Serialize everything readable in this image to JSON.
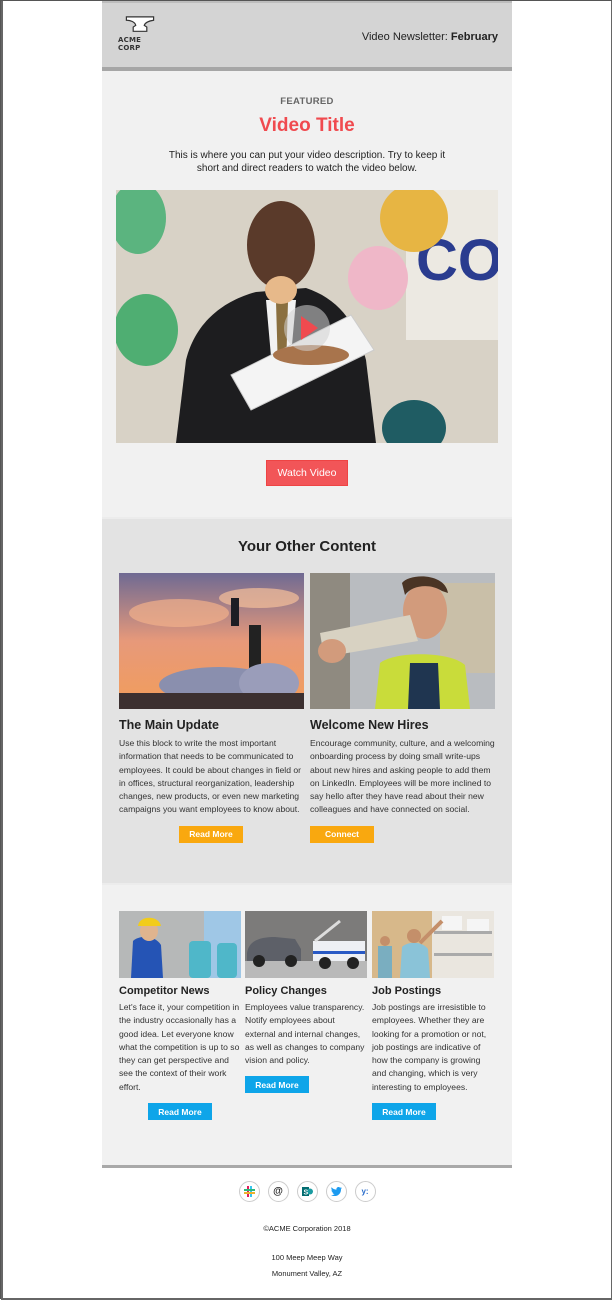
{
  "header": {
    "logo_text": "ACME CORP",
    "title_prefix": "Video Newsletter: ",
    "title_month": "February"
  },
  "featured": {
    "label": "FEATURED",
    "title": "Video Title",
    "description": "This is where you can put your video description. Try to keep it short and direct readers to watch the video below.",
    "thumbnail_alt": "Man in suit eating a sprinkled donut at an office party with balloons and streamers",
    "button_label": "Watch Video",
    "accent_color": "#f04a4f"
  },
  "other_content": {
    "heading": "Your Other Content",
    "cards": [
      {
        "title": "The Main Update",
        "image_alt": "Rocket launch at sunset",
        "body": "Use this block to write the most important information that needs to be communicated to employees. It could be about changes in field or in offices, structural reorganization, leadership changes, new products, or even new marketing campaigns you want employees to know about.",
        "button_label": "Read More"
      },
      {
        "title": "Welcome New Hires",
        "image_alt": "Smiling warehouse worker in hi-vis vest carrying a sack",
        "body": "Encourage community, culture, and a welcoming onboarding process by doing small write-ups about new hires and asking people to add them on LinkedIn. Employees will be more inclined to say hello after they have read about their new colleagues and have connected on social.",
        "button_label": "Connect"
      }
    ],
    "button_color": "#f9a80f"
  },
  "three_column": {
    "cards": [
      {
        "title": "Competitor News",
        "image_alt": "Engineer in hard hat working on blue machinery",
        "body": "Let's face it, your competition in the industry occasionally has a good idea. Let everyone know what the competition is up to so they can get perspective and see the context of their work effort.",
        "button_label": "Read More"
      },
      {
        "title": "Policy Changes",
        "image_alt": "Tow truck towing a car",
        "body": "Employees value transparency. Notify employees about external and internal changes, as well as changes to company vision and policy.",
        "button_label": "Read More"
      },
      {
        "title": "Job Postings",
        "image_alt": "Workers stocking supply shelves",
        "body": "Job postings are irresistible to employees. Whether they are looking for a promotion or not, job postings are indicative of how the company is growing and changing, which is very interesting to employees.",
        "button_label": "Read More"
      }
    ],
    "button_color": "#0ea5e9"
  },
  "footer": {
    "social": [
      {
        "name": "slack-icon",
        "glyph": "#"
      },
      {
        "name": "workplace-icon",
        "glyph": "@"
      },
      {
        "name": "sharepoint-icon",
        "glyph": "S"
      },
      {
        "name": "twitter-icon",
        "glyph": "t"
      },
      {
        "name": "yammer-icon",
        "glyph": "y:"
      }
    ],
    "copyright": "©ACME Corporation 2018",
    "address_line1": "100 Meep Meep Way",
    "address_line2": "Monument Valley, AZ"
  }
}
